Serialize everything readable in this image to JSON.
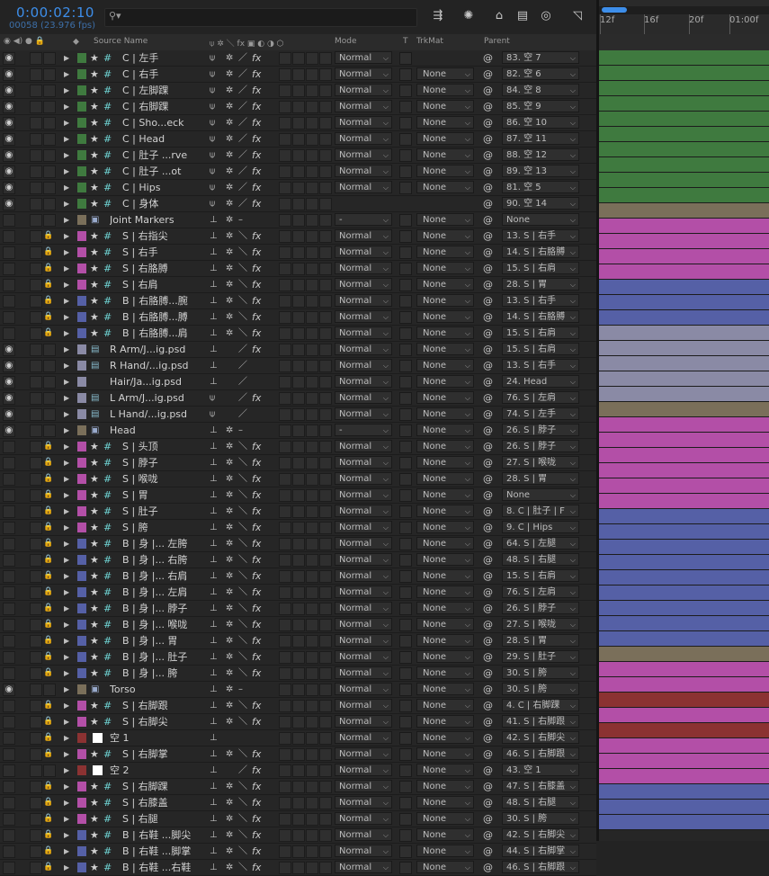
{
  "timecode": "0:00:02:10",
  "frame_info": "00058 (23.976 fps)",
  "search": {
    "placeholder": ""
  },
  "columns": {
    "source_name": "Source Name",
    "mode": "Mode",
    "t": "T",
    "trkmat": "TrkMat",
    "parent": "Parent"
  },
  "ruler": {
    "ticks": [
      "12f",
      "16f",
      "20f",
      "01:00f"
    ]
  },
  "colors": {
    "green": "#3f7a3f",
    "pink": "#b34fa7",
    "blue": "#5560a6",
    "tan": "#7a6f5a",
    "lilac": "#8a8aa5",
    "red": "#8b3232",
    "accent": "#3d8eea"
  },
  "rows": [
    {
      "eye": true,
      "lock": false,
      "label": "green",
      "icon": "star-hash",
      "name": "C | 左手",
      "s1": "⍦",
      "s2": "✲",
      "s3": "／",
      "fx": true,
      "mode": "Normal",
      "trk": "",
      "pw": "@",
      "parent": "83. 空 7"
    },
    {
      "eye": true,
      "lock": false,
      "label": "green",
      "icon": "star-hash",
      "name": "C | 右手",
      "s1": "⍦",
      "s2": "✲",
      "s3": "／",
      "fx": true,
      "mode": "Normal",
      "trk": "None",
      "pw": "@",
      "parent": "82. 空 6"
    },
    {
      "eye": true,
      "lock": false,
      "label": "green",
      "icon": "star-hash",
      "name": "C | 左脚踝",
      "s1": "⍦",
      "s2": "✲",
      "s3": "／",
      "fx": true,
      "mode": "Normal",
      "trk": "None",
      "pw": "@",
      "parent": "84. 空 8"
    },
    {
      "eye": true,
      "lock": false,
      "label": "green",
      "icon": "star-hash",
      "name": "C | 右脚踝",
      "s1": "⍦",
      "s2": "✲",
      "s3": "／",
      "fx": true,
      "mode": "Normal",
      "trk": "None",
      "pw": "@",
      "parent": "85. 空 9"
    },
    {
      "eye": true,
      "lock": false,
      "label": "green",
      "icon": "star-hash",
      "name": "C | Sho...eck",
      "s1": "⍦",
      "s2": "✲",
      "s3": "／",
      "fx": true,
      "mode": "Normal",
      "trk": "None",
      "pw": "@",
      "parent": "86. 空 10"
    },
    {
      "eye": true,
      "lock": false,
      "label": "green",
      "icon": "star-hash",
      "name": "C | Head",
      "s1": "⍦",
      "s2": "✲",
      "s3": "／",
      "fx": true,
      "mode": "Normal",
      "trk": "None",
      "pw": "@",
      "parent": "87. 空 11"
    },
    {
      "eye": true,
      "lock": false,
      "label": "green",
      "icon": "star-hash",
      "name": "C | 肚子 ...rve",
      "s1": "⍦",
      "s2": "✲",
      "s3": "／",
      "fx": true,
      "mode": "Normal",
      "trk": "None",
      "pw": "@",
      "parent": "88. 空 12"
    },
    {
      "eye": true,
      "lock": false,
      "label": "green",
      "icon": "star-hash",
      "name": "C | 肚子 ...ot",
      "s1": "⍦",
      "s2": "✲",
      "s3": "／",
      "fx": true,
      "mode": "Normal",
      "trk": "None",
      "pw": "@",
      "parent": "89. 空 13"
    },
    {
      "eye": true,
      "lock": false,
      "label": "green",
      "icon": "star-hash",
      "name": "C | Hips",
      "s1": "⍦",
      "s2": "✲",
      "s3": "／",
      "fx": true,
      "mode": "Normal",
      "trk": "None",
      "pw": "@",
      "parent": "81. 空 5"
    },
    {
      "eye": true,
      "lock": false,
      "label": "green",
      "icon": "star-hash",
      "name": "C | 身体",
      "s1": "⍦",
      "s2": "✲",
      "s3": "／",
      "fx": true,
      "mode": "",
      "trk": "",
      "pw": "@",
      "parent": "90. 空 14"
    },
    {
      "eye": false,
      "lock": false,
      "label": "tan",
      "icon": "comp",
      "name": "Joint Markers",
      "s1": "⊥",
      "s2": "✲",
      "s3": "–",
      "fx": false,
      "mode": "-",
      "trk": "None",
      "pw": "@",
      "parent": "None"
    },
    {
      "eye": false,
      "lock": true,
      "label": "pink",
      "icon": "star",
      "name": "S | 右指尖",
      "s1": "⊥",
      "s2": "✲",
      "s3": "＼",
      "fx": true,
      "mode": "Normal",
      "trk": "None",
      "pw": "@",
      "parent": "13. S | 右手"
    },
    {
      "eye": false,
      "lock": true,
      "label": "pink",
      "icon": "star",
      "name": "S | 右手",
      "s1": "⊥",
      "s2": "✲",
      "s3": "＼",
      "fx": true,
      "mode": "Normal",
      "trk": "None",
      "pw": "@",
      "parent": "14. S | 右胳膊"
    },
    {
      "eye": false,
      "lock": true,
      "label": "pink",
      "icon": "star",
      "name": "S | 右胳膊",
      "s1": "⊥",
      "s2": "✲",
      "s3": "＼",
      "fx": true,
      "mode": "Normal",
      "trk": "None",
      "pw": "@",
      "parent": "15. S | 右肩"
    },
    {
      "eye": false,
      "lock": true,
      "label": "pink",
      "icon": "star",
      "name": "S | 右肩",
      "s1": "⊥",
      "s2": "✲",
      "s3": "＼",
      "fx": true,
      "mode": "Normal",
      "trk": "None",
      "pw": "@",
      "parent": "28. S | 胃"
    },
    {
      "eye": false,
      "lock": true,
      "label": "blue",
      "icon": "star",
      "name": "B | 右胳膊...腕",
      "s1": "⊥",
      "s2": "✲",
      "s3": "＼",
      "fx": true,
      "mode": "Normal",
      "trk": "None",
      "pw": "@",
      "parent": "13. S | 右手"
    },
    {
      "eye": false,
      "lock": true,
      "label": "blue",
      "icon": "star",
      "name": "B | 右胳膊...膊",
      "s1": "⊥",
      "s2": "✲",
      "s3": "＼",
      "fx": true,
      "mode": "Normal",
      "trk": "None",
      "pw": "@",
      "parent": "14. S | 右胳膊"
    },
    {
      "eye": false,
      "lock": true,
      "label": "blue",
      "icon": "star",
      "name": "B | 右胳膊...肩",
      "s1": "⊥",
      "s2": "✲",
      "s3": "＼",
      "fx": true,
      "mode": "Normal",
      "trk": "None",
      "pw": "@",
      "parent": "15. S | 右肩"
    },
    {
      "eye": true,
      "lock": false,
      "label": "lilac",
      "icon": "psd",
      "name": "R Arm/J...ig.psd",
      "s1": "⊥",
      "s2": "",
      "s3": "／",
      "fx": true,
      "mode": "Normal",
      "trk": "None",
      "pw": "@",
      "parent": "15. S | 右肩"
    },
    {
      "eye": true,
      "lock": false,
      "label": "lilac",
      "icon": "psd",
      "name": "R Hand/...ig.psd",
      "s1": "⊥",
      "s2": "",
      "s3": "／",
      "fx": false,
      "mode": "Normal",
      "trk": "None",
      "pw": "@",
      "parent": "13. S | 右手"
    },
    {
      "eye": true,
      "lock": false,
      "label": "lilac",
      "icon": "none",
      "name": "Hair/Ja...ig.psd",
      "s1": "⊥",
      "s2": "",
      "s3": "／",
      "fx": false,
      "mode": "Normal",
      "trk": "None",
      "pw": "@",
      "parent": "24. Head"
    },
    {
      "eye": true,
      "lock": false,
      "label": "lilac",
      "icon": "psd",
      "name": "L Arm/J...ig.psd",
      "s1": "⍦",
      "s2": "",
      "s3": "／",
      "fx": true,
      "mode": "Normal",
      "trk": "None",
      "pw": "@",
      "parent": "76. S | 左肩"
    },
    {
      "eye": true,
      "lock": false,
      "label": "lilac",
      "icon": "psd",
      "name": "L Hand/...ig.psd",
      "s1": "⍦",
      "s2": "",
      "s3": "／",
      "fx": false,
      "mode": "Normal",
      "trk": "None",
      "pw": "@",
      "parent": "74. S | 左手"
    },
    {
      "eye": true,
      "lock": false,
      "label": "tan",
      "icon": "comp",
      "name": "Head",
      "s1": "⊥",
      "s2": "✲",
      "s3": "–",
      "fx": false,
      "mode": "-",
      "trk": "None",
      "pw": "@",
      "parent": "26. S | 脖子"
    },
    {
      "eye": false,
      "lock": true,
      "label": "pink",
      "icon": "star",
      "name": "S | 头顶",
      "s1": "⊥",
      "s2": "✲",
      "s3": "＼",
      "fx": true,
      "mode": "Normal",
      "trk": "None",
      "pw": "@",
      "parent": "26. S | 脖子"
    },
    {
      "eye": false,
      "lock": true,
      "label": "pink",
      "icon": "star",
      "name": "S | 脖子",
      "s1": "⊥",
      "s2": "✲",
      "s3": "＼",
      "fx": true,
      "mode": "Normal",
      "trk": "None",
      "pw": "@",
      "parent": "27. S | 喉咙"
    },
    {
      "eye": false,
      "lock": true,
      "label": "pink",
      "icon": "star",
      "name": "S | 喉咙",
      "s1": "⊥",
      "s2": "✲",
      "s3": "＼",
      "fx": true,
      "mode": "Normal",
      "trk": "None",
      "pw": "@",
      "parent": "28. S | 胃"
    },
    {
      "eye": false,
      "lock": true,
      "label": "pink",
      "icon": "star",
      "name": "S | 胃",
      "s1": "⊥",
      "s2": "✲",
      "s3": "＼",
      "fx": true,
      "mode": "Normal",
      "trk": "None",
      "pw": "@",
      "parent": "None"
    },
    {
      "eye": false,
      "lock": true,
      "label": "pink",
      "icon": "star",
      "name": "S | 肚子",
      "s1": "⊥",
      "s2": "✲",
      "s3": "＼",
      "fx": true,
      "mode": "Normal",
      "trk": "None",
      "pw": "@",
      "parent": "8. C | 肚子 | F"
    },
    {
      "eye": false,
      "lock": true,
      "label": "pink",
      "icon": "star",
      "name": "S | 胯",
      "s1": "⊥",
      "s2": "✲",
      "s3": "＼",
      "fx": true,
      "mode": "Normal",
      "trk": "None",
      "pw": "@",
      "parent": "9. C | Hips"
    },
    {
      "eye": false,
      "lock": true,
      "label": "blue",
      "icon": "star",
      "name": "B | 身 |... 左胯",
      "s1": "⊥",
      "s2": "✲",
      "s3": "＼",
      "fx": true,
      "mode": "Normal",
      "trk": "None",
      "pw": "@",
      "parent": "64. S | 左腿"
    },
    {
      "eye": false,
      "lock": true,
      "label": "blue",
      "icon": "star",
      "name": "B | 身 |... 右胯",
      "s1": "⊥",
      "s2": "✲",
      "s3": "＼",
      "fx": true,
      "mode": "Normal",
      "trk": "None",
      "pw": "@",
      "parent": "48. S | 右腿"
    },
    {
      "eye": false,
      "lock": true,
      "label": "blue",
      "icon": "star",
      "name": "B | 身 |... 右肩",
      "s1": "⊥",
      "s2": "✲",
      "s3": "＼",
      "fx": true,
      "mode": "Normal",
      "trk": "None",
      "pw": "@",
      "parent": "15. S | 右肩"
    },
    {
      "eye": false,
      "lock": true,
      "label": "blue",
      "icon": "star",
      "name": "B | 身 |... 左肩",
      "s1": "⊥",
      "s2": "✲",
      "s3": "＼",
      "fx": true,
      "mode": "Normal",
      "trk": "None",
      "pw": "@",
      "parent": "76. S | 左肩"
    },
    {
      "eye": false,
      "lock": true,
      "label": "blue",
      "icon": "star",
      "name": "B | 身 |... 脖子",
      "s1": "⊥",
      "s2": "✲",
      "s3": "＼",
      "fx": true,
      "mode": "Normal",
      "trk": "None",
      "pw": "@",
      "parent": "26. S | 脖子"
    },
    {
      "eye": false,
      "lock": true,
      "label": "blue",
      "icon": "star",
      "name": "B | 身 |... 喉咙",
      "s1": "⊥",
      "s2": "✲",
      "s3": "＼",
      "fx": true,
      "mode": "Normal",
      "trk": "None",
      "pw": "@",
      "parent": "27. S | 喉咙"
    },
    {
      "eye": false,
      "lock": true,
      "label": "blue",
      "icon": "star",
      "name": "B | 身 |... 胃",
      "s1": "⊥",
      "s2": "✲",
      "s3": "＼",
      "fx": true,
      "mode": "Normal",
      "trk": "None",
      "pw": "@",
      "parent": "28. S | 胃"
    },
    {
      "eye": false,
      "lock": true,
      "label": "blue",
      "icon": "star",
      "name": "B | 身 |... 肚子",
      "s1": "⊥",
      "s2": "✲",
      "s3": "＼",
      "fx": true,
      "mode": "Normal",
      "trk": "None",
      "pw": "@",
      "parent": "29. S | 肚子"
    },
    {
      "eye": false,
      "lock": true,
      "label": "blue",
      "icon": "star",
      "name": "B | 身 |... 胯",
      "s1": "⊥",
      "s2": "✲",
      "s3": "＼",
      "fx": true,
      "mode": "Normal",
      "trk": "None",
      "pw": "@",
      "parent": "30. S | 胯"
    },
    {
      "eye": true,
      "lock": false,
      "label": "tan",
      "icon": "comp",
      "name": "Torso",
      "s1": "⊥",
      "s2": "✲",
      "s3": "–",
      "fx": false,
      "mode": "Normal",
      "trk": "None",
      "pw": "@",
      "parent": "30. S | 胯"
    },
    {
      "eye": false,
      "lock": true,
      "label": "pink",
      "icon": "star",
      "name": "S | 右脚跟",
      "s1": "⊥",
      "s2": "✲",
      "s3": "＼",
      "fx": true,
      "mode": "Normal",
      "trk": "None",
      "pw": "@",
      "parent": "4. C | 右脚踝"
    },
    {
      "eye": false,
      "lock": true,
      "label": "pink",
      "icon": "star",
      "name": "S | 右脚尖",
      "s1": "⊥",
      "s2": "✲",
      "s3": "＼",
      "fx": true,
      "mode": "Normal",
      "trk": "None",
      "pw": "@",
      "parent": "41. S | 右脚跟"
    },
    {
      "eye": false,
      "lock": true,
      "label": "red",
      "icon": "white",
      "name": "空 1",
      "s1": "⊥",
      "s2": "",
      "s3": "",
      "fx": false,
      "mode": "Normal",
      "trk": "None",
      "pw": "@",
      "parent": "42. S | 右脚尖"
    },
    {
      "eye": false,
      "lock": true,
      "label": "pink",
      "icon": "star",
      "name": "S | 右脚掌",
      "s1": "⊥",
      "s2": "✲",
      "s3": "＼",
      "fx": true,
      "mode": "Normal",
      "trk": "None",
      "pw": "@",
      "parent": "46. S | 右脚跟"
    },
    {
      "eye": false,
      "lock": false,
      "label": "red",
      "icon": "white",
      "name": "空 2",
      "s1": "⊥",
      "s2": "",
      "s3": "／",
      "fx": true,
      "mode": "Normal",
      "trk": "None",
      "pw": "@",
      "parent": "43. 空 1"
    },
    {
      "eye": false,
      "lock": true,
      "label": "pink",
      "icon": "star",
      "name": "S | 右脚踝",
      "s1": "⊥",
      "s2": "✲",
      "s3": "＼",
      "fx": true,
      "mode": "Normal",
      "trk": "None",
      "pw": "@",
      "parent": "47. S | 右膝盖"
    },
    {
      "eye": false,
      "lock": true,
      "label": "pink",
      "icon": "star",
      "name": "S | 右膝盖",
      "s1": "⊥",
      "s2": "✲",
      "s3": "＼",
      "fx": true,
      "mode": "Normal",
      "trk": "None",
      "pw": "@",
      "parent": "48. S | 右腿"
    },
    {
      "eye": false,
      "lock": true,
      "label": "pink",
      "icon": "star",
      "name": "S | 右腿",
      "s1": "⊥",
      "s2": "✲",
      "s3": "＼",
      "fx": true,
      "mode": "Normal",
      "trk": "None",
      "pw": "@",
      "parent": "30. S | 胯"
    },
    {
      "eye": false,
      "lock": true,
      "label": "blue",
      "icon": "star",
      "name": "B | 右鞋 ...脚尖",
      "s1": "⊥",
      "s2": "✲",
      "s3": "＼",
      "fx": true,
      "mode": "Normal",
      "trk": "None",
      "pw": "@",
      "parent": "42. S | 右脚尖"
    },
    {
      "eye": false,
      "lock": true,
      "label": "blue",
      "icon": "star",
      "name": "B | 右鞋 ...脚掌",
      "s1": "⊥",
      "s2": "✲",
      "s3": "＼",
      "fx": true,
      "mode": "Normal",
      "trk": "None",
      "pw": "@",
      "parent": "44. S | 右脚掌"
    },
    {
      "eye": false,
      "lock": true,
      "label": "blue",
      "icon": "star",
      "name": "B | 右鞋 ...右鞋",
      "s1": "⊥",
      "s2": "✲",
      "s3": "＼",
      "fx": true,
      "mode": "Normal",
      "trk": "None",
      "pw": "@",
      "parent": "46. S | 右脚跟"
    }
  ]
}
